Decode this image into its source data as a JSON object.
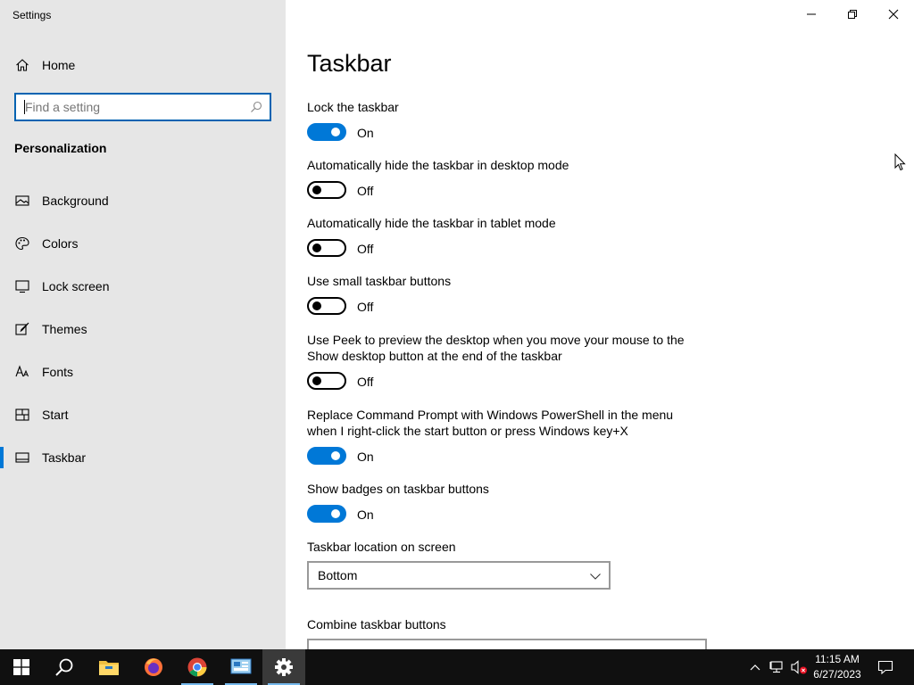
{
  "window": {
    "title": "Settings"
  },
  "sidebar": {
    "home_label": "Home",
    "search_placeholder": "Find a setting",
    "section_title": "Personalization",
    "items": [
      {
        "label": "Background",
        "icon": "picture-icon"
      },
      {
        "label": "Colors",
        "icon": "palette-icon"
      },
      {
        "label": "Lock screen",
        "icon": "monitor-lock-icon"
      },
      {
        "label": "Themes",
        "icon": "brush-icon"
      },
      {
        "label": "Fonts",
        "icon": "font-icon"
      },
      {
        "label": "Start",
        "icon": "start-tiles-icon"
      },
      {
        "label": "Taskbar",
        "icon": "taskbar-icon",
        "selected": true
      }
    ]
  },
  "content": {
    "title": "Taskbar",
    "settings": [
      {
        "label": "Lock the taskbar",
        "state": "On"
      },
      {
        "label": "Automatically hide the taskbar in desktop mode",
        "state": "Off"
      },
      {
        "label": "Automatically hide the taskbar in tablet mode",
        "state": "Off"
      },
      {
        "label": "Use small taskbar buttons",
        "state": "Off"
      },
      {
        "label": "Use Peek to preview the desktop when you move your mouse to the Show desktop button at the end of the taskbar",
        "state": "Off"
      },
      {
        "label": "Replace Command Prompt with Windows PowerShell in the menu when I right-click the start button or press Windows key+X",
        "state": "On"
      },
      {
        "label": "Show badges on taskbar buttons",
        "state": "On"
      }
    ],
    "location_label": "Taskbar location on screen",
    "location_value": "Bottom",
    "combine_label": "Combine taskbar buttons",
    "accent_color": "#0078d7"
  },
  "taskbar": {
    "apps": [
      "start-icon",
      "search-icon",
      "file-explorer-icon",
      "firefox-icon",
      "chrome-icon",
      "control-panel-icon",
      "settings-icon"
    ],
    "time": "11:15 AM",
    "date": "6/27/2023"
  }
}
